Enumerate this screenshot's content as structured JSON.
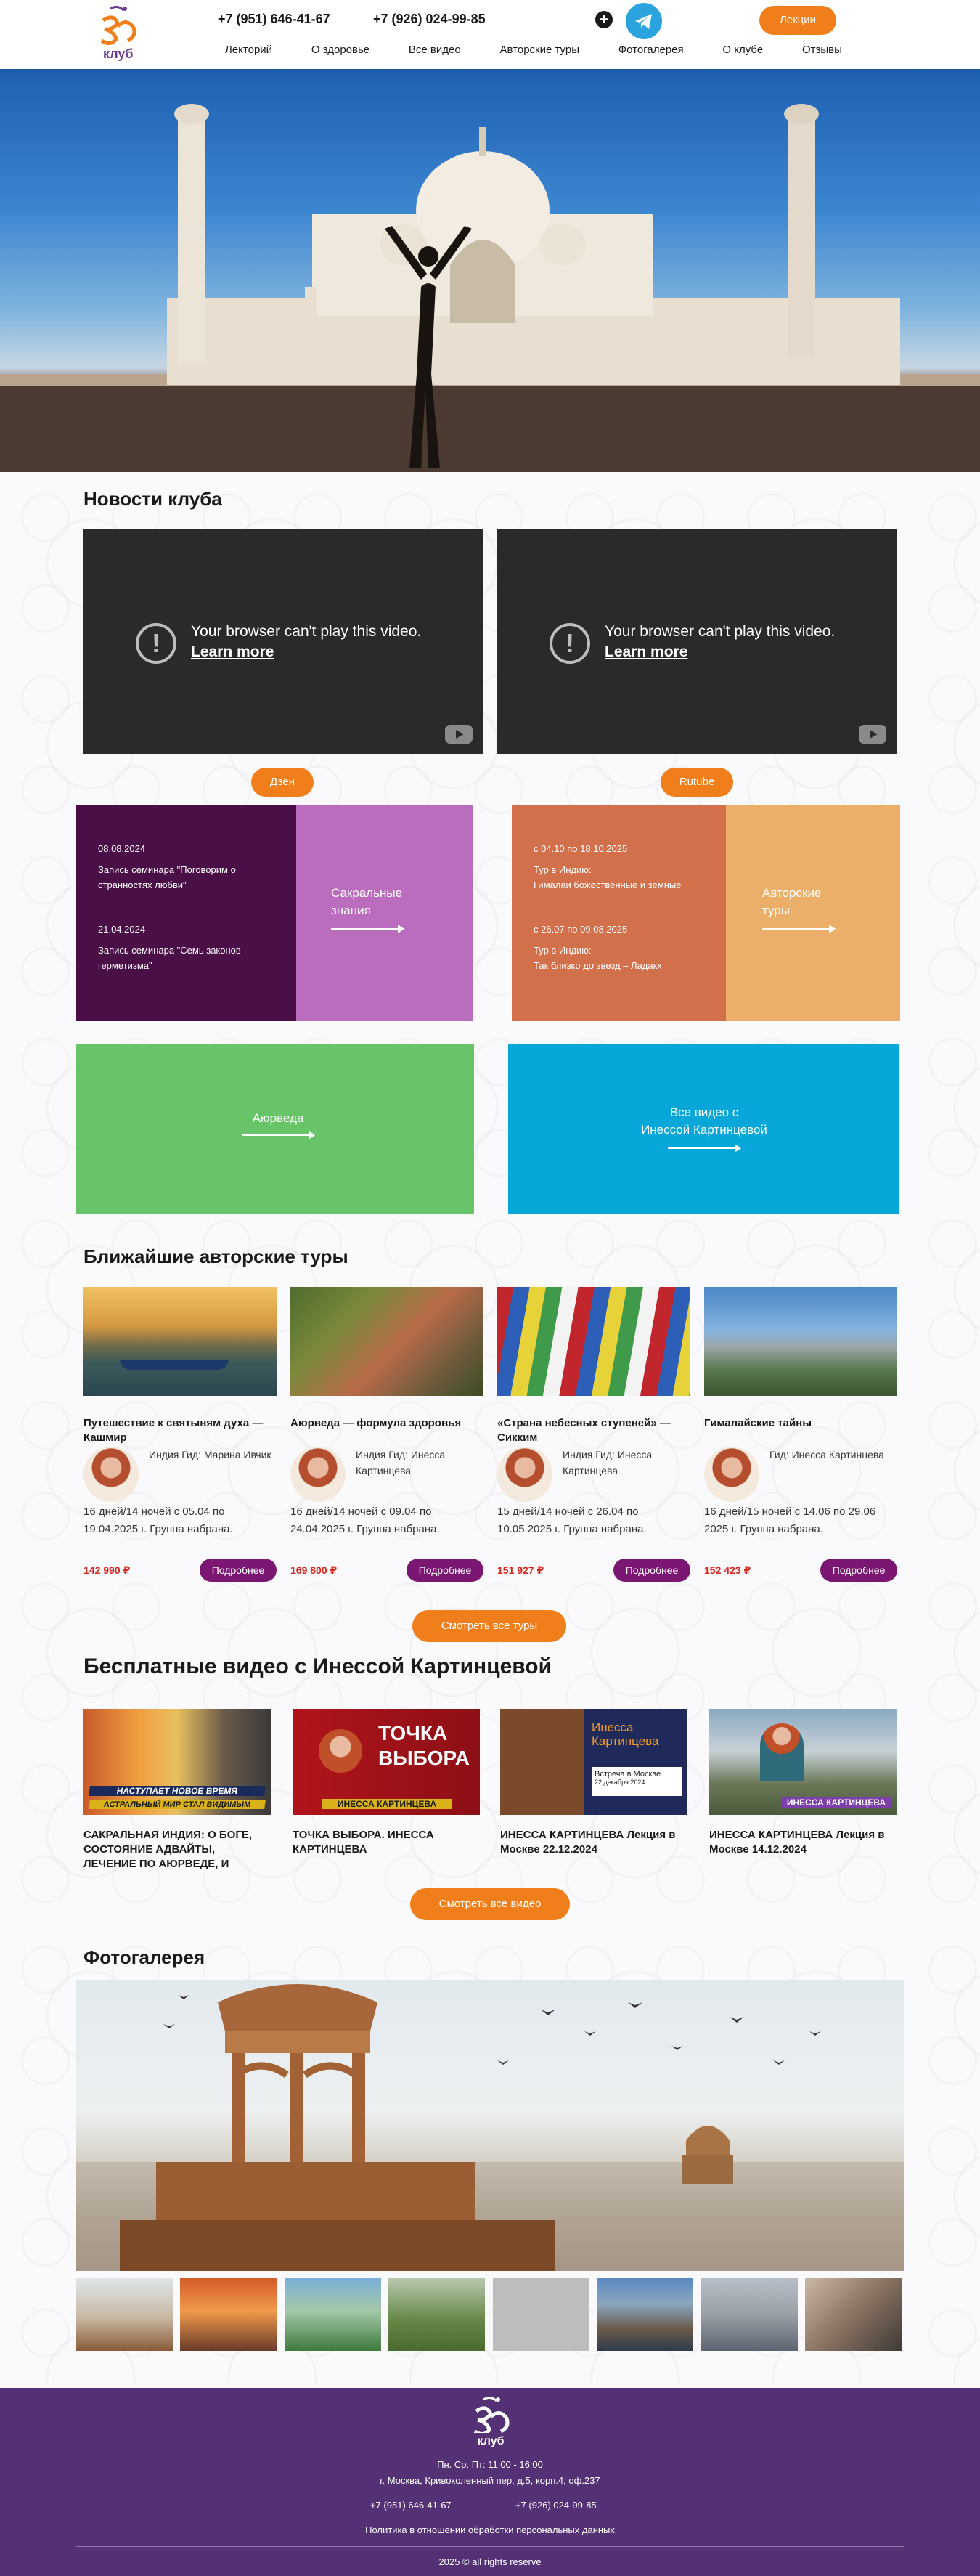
{
  "header": {
    "logo_top": "ОМ",
    "logo_bottom": "клуб",
    "phone1": "+7 (951) 646-41-67",
    "phone2": "+7 (926) 024-99-85",
    "plus_icon": "+",
    "lectures_btn": "Лекции",
    "nav": [
      "Лекторий",
      "О здоровье",
      "Все видео",
      "Авторские туры",
      "Фотогалерея",
      "О клубе",
      "Отзывы"
    ]
  },
  "news": {
    "title": "Новости клуба",
    "videos": [
      {
        "message": "Your browser can't play this video.",
        "link": "Learn more",
        "button": "Дзен"
      },
      {
        "message": "Your browser can't play this video.",
        "link": "Learn more",
        "button": "Rutube"
      }
    ]
  },
  "blocks": {
    "sacred": {
      "date1": "08.08.2024",
      "text1": "Запись семинара \"Поговорим о странностях любви\"",
      "date2": "21.04.2024",
      "text2": "Запись семинара \"Семь законов герметизма\"",
      "label_line1": "Сакральные",
      "label_line2": "знания"
    },
    "tours": {
      "date1": "с 04.10 по 18.10.2025",
      "text1a": "Тур в Индию:",
      "text1b": "Гималаи божественные и земные",
      "date2": "с 26.07 по 09.08.2025",
      "text2a": "Тур в Индию:",
      "text2b": "Так близко до звезд – Ладакх",
      "label_line1": "Авторские",
      "label_line2": "туры"
    },
    "ayurveda": "Аюрведа",
    "all_videos_line1": "Все видео с",
    "all_videos_line2": "Инессой Картинцевой"
  },
  "nearest_tours": {
    "title": "Ближайшие авторские туры",
    "items": [
      {
        "title": "Путешествие к святыням духа — Кашмир",
        "guide": "Индия Гид: Марина Ивчик",
        "dates": "16 дней/14 ночей с 05.04 по 19.04.2025 г. Группа набрана.",
        "price": "142 990 ₽",
        "button": "Подробнее"
      },
      {
        "title": "Аюрведа — формула здоровья",
        "guide": "Индия Гид: Инесса Картинцева",
        "dates": "16 дней/14 ночей с 09.04 по 24.04.2025 г. Группа набрана.",
        "price": "169 800 ₽",
        "button": "Подробнее"
      },
      {
        "title": "«Страна небесных ступеней» — Сикким",
        "guide": "Индия Гид: Инесса Картинцева",
        "dates": "15 дней/14 ночей с 26.04 по 10.05.2025 г. Группа набрана.",
        "price": "151 927 ₽",
        "button": "Подробнее"
      },
      {
        "title": "Гималайские тайны",
        "guide": "Гид: Инесса Картинцева",
        "dates": "16 дней/15 ночей с 14.06 по 29.06 2025 г. Группа набрана.",
        "price": "152 423 ₽",
        "button": "Подробнее"
      }
    ],
    "all_button": "Смотреть все туры"
  },
  "free_videos": {
    "title": "Бесплатные видео с Инессой Картинцевой",
    "items": [
      {
        "title": "САКРАЛЬНАЯ ИНДИЯ: О БОГЕ, СОСТОЯНИЕ АДВАЙТЫ, ЛЕЧЕНИЕ ПО АЮРВЕДЕ, И",
        "thumb_line1": "НАСТУПАЕТ НОВОЕ ВРЕМЯ",
        "thumb_line2": "АСТРАЛЬНЫЙ МИР СТАЛ ВИДИМЫМ"
      },
      {
        "title": "ТОЧКА ВЫБОРА. ИНЕССА КАРТИНЦЕВА",
        "thumb_line1": "ТОЧКА",
        "thumb_line2": "ВЫБОРА",
        "thumb_line3": "ИНЕССА КАРТИНЦЕВА"
      },
      {
        "title": "ИНЕССА КАРТИНЦЕВА Лекция в Москве 22.12.2024",
        "thumb_line1": "Инесса",
        "thumb_line2": "Картинцева",
        "thumb_line3": "Встреча в Москве",
        "thumb_line4": "22 декабря 2024"
      },
      {
        "title": "ИНЕССА КАРТИНЦЕВА Лекция в Москве 14.12.2024",
        "thumb_line1": "ИНЕССА КАРТИНЦЕВА"
      }
    ],
    "all_button": "Смотреть все видео"
  },
  "gallery": {
    "title": "Фотогалерея"
  },
  "footer": {
    "logo_top": "ОМ",
    "logo_bottom": "клуб",
    "hours": "Пн. Ср. Пт: 11:00 - 16:00",
    "address": "г. Москва, Кривоколенный пер, д.5, корп.4, оф.237",
    "phone1": "+7 (951) 646-41-67",
    "phone2": "+7 (926) 024-99-85",
    "policy": "Политика в отношении обработки персональных данных",
    "copyright": "2025 © all rights reserve"
  }
}
